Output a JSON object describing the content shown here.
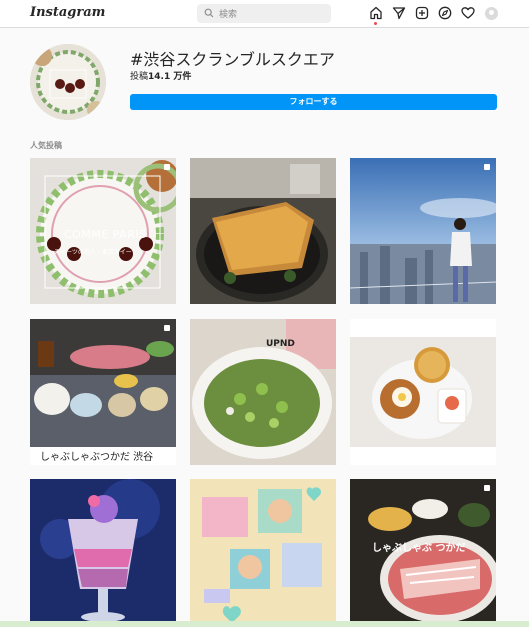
{
  "topbar": {
    "logo": "Instagram",
    "search_placeholder": "検索",
    "icons": [
      "home-icon",
      "direct-icon",
      "new-post-icon",
      "explore-icon",
      "activity-icon",
      "profile-avatar"
    ]
  },
  "hashtag": {
    "title": "#渋谷スクランブルスクエア",
    "posts_label": "投稿",
    "posts_count": "14.1 万件",
    "follow_label": "フォローする"
  },
  "section": {
    "label": "人気投稿"
  },
  "tiles": [
    {
      "overlay": "COMME PARIS",
      "overlay_small": "スイーツの恋人 / 東京スイーツ",
      "multi": true
    },
    {
      "overlay": "",
      "multi": false
    },
    {
      "overlay": "",
      "multi": true
    },
    {
      "overlay": "しゃぶしゃぶつかだ 渋谷",
      "multi": true
    },
    {
      "overlay": "UPND",
      "multi": false
    },
    {
      "overlay": "",
      "multi": false
    },
    {
      "overlay": "",
      "multi": true
    },
    {
      "overlay": "",
      "multi": false
    },
    {
      "overlay": "しゃぶしゃぶ つかだ",
      "multi": true
    }
  ],
  "colors": {
    "accent": "#0095f6",
    "border": "#dbdbdb",
    "background": "#fafafa"
  }
}
